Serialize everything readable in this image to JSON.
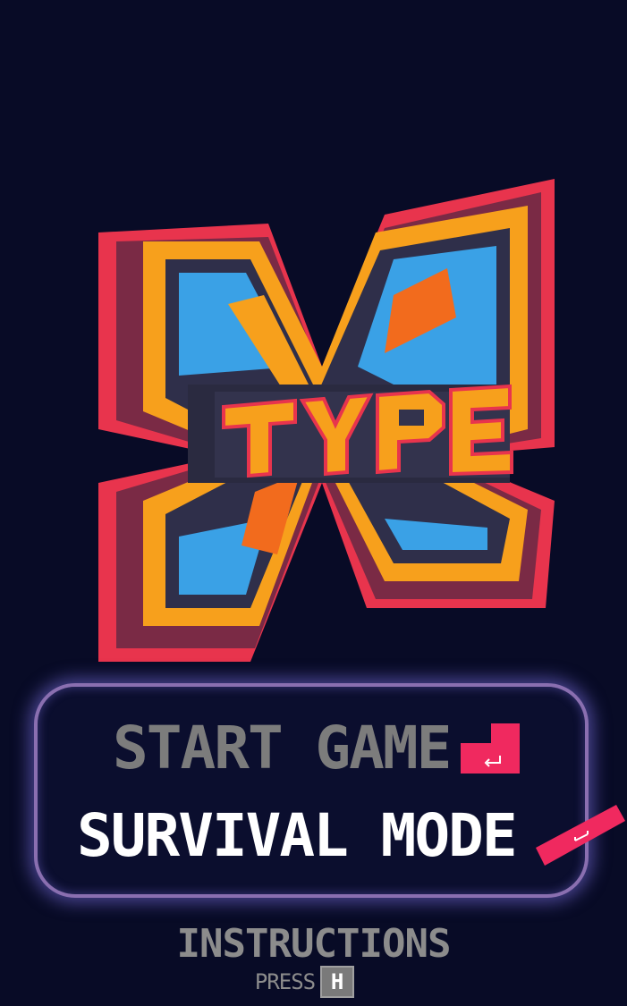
{
  "logo": {
    "word": "TYPE",
    "letter": "X"
  },
  "menu": {
    "items": [
      {
        "label": "START GAME",
        "key_icon": "enter-key-icon",
        "selected": false
      },
      {
        "label": "SURVIVAL MODE",
        "key_icon": "spacebar-key-icon",
        "selected": true
      }
    ]
  },
  "footer": {
    "instructions_label": "INSTRUCTIONS",
    "press_label": "PRESS",
    "key": "H"
  },
  "colors": {
    "background": "#080b26",
    "accent_pink": "#f0295f",
    "logo_orange": "#f7a01c",
    "logo_red": "#e8344d",
    "logo_blue": "#3aa1e6",
    "menu_border": "#8a6fb0",
    "inactive_text": "#7c7c7c",
    "active_text": "#ffffff"
  }
}
